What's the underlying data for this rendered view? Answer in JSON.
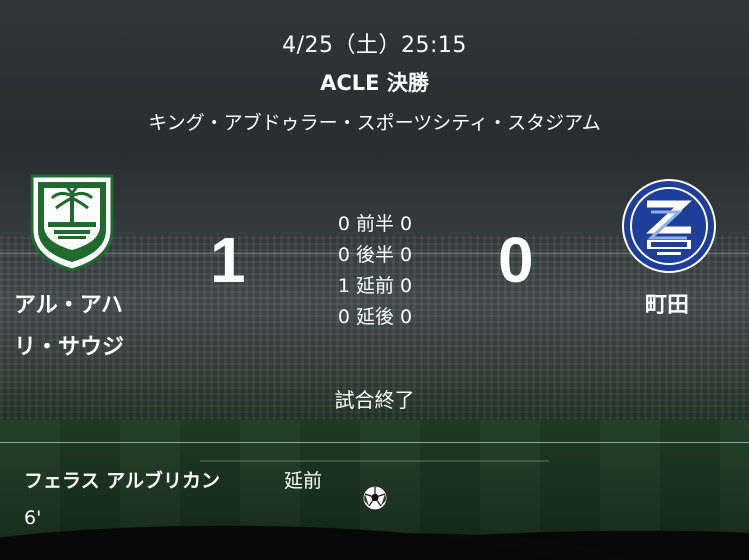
{
  "match": {
    "date": "4/25（土）25:15",
    "competition": "ACLE 決勝",
    "venue": "キング・アブドゥラー・スポーツシティ・スタジアム",
    "status": "試合終了"
  },
  "home": {
    "name_line1": "アル・アハ",
    "name_line2": "リ・サウジ",
    "score": "1",
    "crest_icon": "al-ahli-crest-icon",
    "crest_color": "#1f6b2e"
  },
  "away": {
    "name": "町田",
    "score": "0",
    "crest_icon": "machida-zelvia-crest-icon",
    "crest_color": "#1d3f9a"
  },
  "periods": [
    {
      "home": "0",
      "label": "前半",
      "away": "0"
    },
    {
      "home": "0",
      "label": "後半",
      "away": "0"
    },
    {
      "home": "1",
      "label": "延前",
      "away": "0"
    },
    {
      "home": "0",
      "label": "延後",
      "away": "0"
    }
  ],
  "events": [
    {
      "player": "フェラス アルブリカン",
      "period": "延前",
      "minute": "6'",
      "icon": "soccer-ball-icon"
    }
  ]
}
